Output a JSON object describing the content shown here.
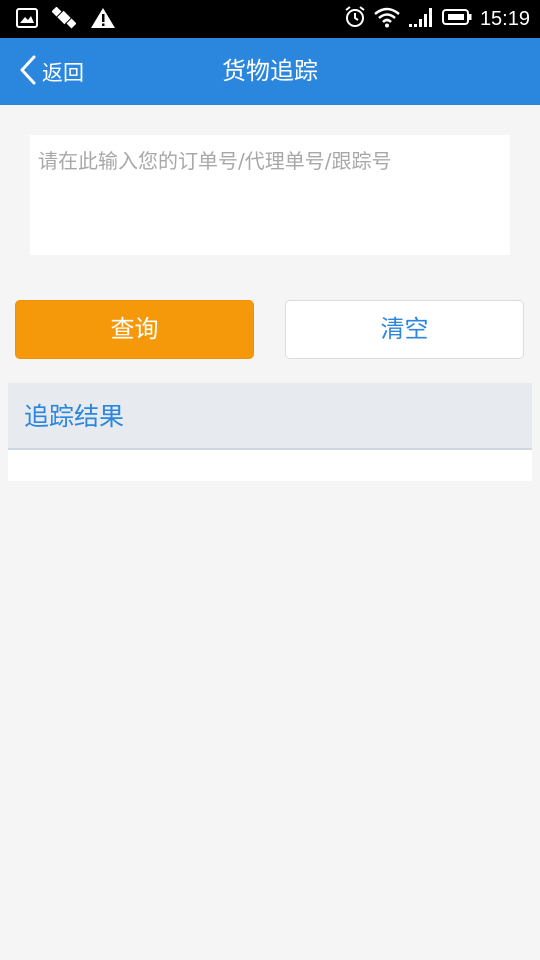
{
  "status_bar": {
    "time": "15:19",
    "left_icons": [
      "image-icon",
      "satellite-icon",
      "warning-icon"
    ],
    "right_icons": [
      "alarm-icon",
      "wifi-icon",
      "signal-icon",
      "battery-icon"
    ]
  },
  "app_bar": {
    "back_label": "返回",
    "title": "货物追踪",
    "color": "#2b86de"
  },
  "search": {
    "value": "",
    "placeholder": "请在此输入您的订单号/代理单号/跟踪号"
  },
  "buttons": {
    "query_label": "查询",
    "clear_label": "清空",
    "query_color": "#f5990a"
  },
  "results": {
    "title": "追踪结果"
  }
}
